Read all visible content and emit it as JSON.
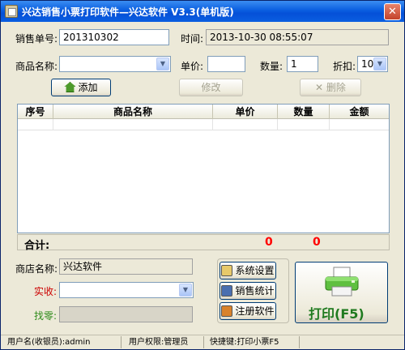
{
  "window": {
    "title": "兴达销售小票打印软件—兴达软件 V3.3(单机版)"
  },
  "sale_no": {
    "label": "销售单号:",
    "value": "201310302"
  },
  "time": {
    "label": "时间:",
    "value": "2013-10-30 08:55:07"
  },
  "product": {
    "label": "商品名称:",
    "value": ""
  },
  "price": {
    "label": "单价:",
    "value": ""
  },
  "qty": {
    "label": "数量:",
    "value": "1"
  },
  "discount": {
    "label": "折扣:",
    "value": "10"
  },
  "buttons": {
    "add": "添加",
    "edit": "修改",
    "delete": "删除"
  },
  "table": {
    "columns": [
      "序号",
      "商品名称",
      "单价",
      "数量",
      "金额"
    ],
    "rows": []
  },
  "totals": {
    "label": "合计:",
    "quantity": "0",
    "amount": "0"
  },
  "shop": {
    "label": "商店名称:",
    "value": "兴达软件"
  },
  "received": {
    "label": "实收:",
    "value": ""
  },
  "change": {
    "label": "找零:",
    "value": ""
  },
  "side_buttons": {
    "settings": "系统设置",
    "stats": "销售统计",
    "register": "注册软件"
  },
  "print_button": {
    "label": "打印(F5)"
  },
  "status": {
    "user": "用户名(收银员):admin",
    "role": "用户权限:管理员",
    "shortcut": "快捷键:打印小票F5"
  },
  "colors": {
    "title_bar": "#0a5ee0",
    "total_text": "#ff0000",
    "received_label": "#cc0000",
    "change_label": "#2e8b1a",
    "print_text": "#1f7a1f"
  },
  "icons": [
    "document-icon",
    "close-icon",
    "home-add-icon",
    "delete-x-icon",
    "settings-icon",
    "stats-icon",
    "register-icon",
    "printer-icon"
  ]
}
